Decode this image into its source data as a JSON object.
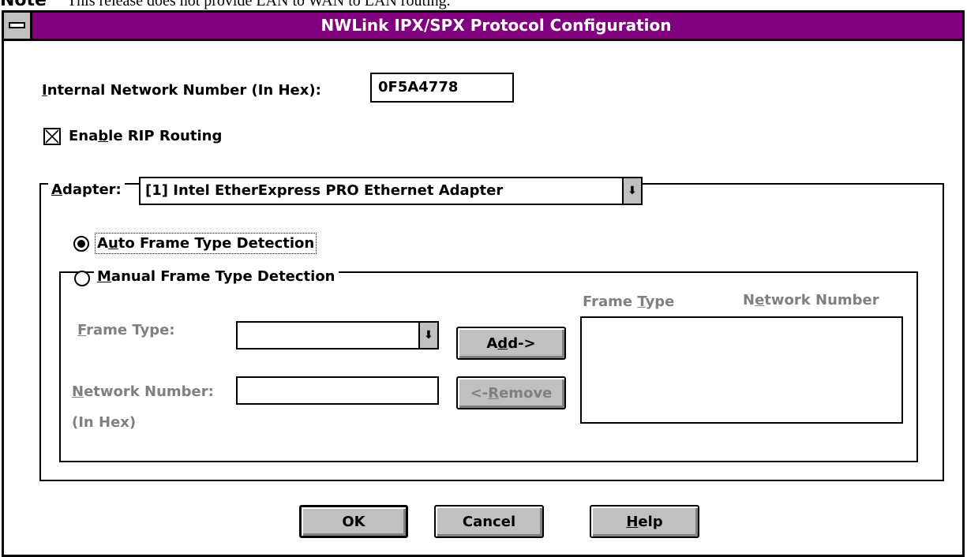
{
  "note": {
    "label": "Note",
    "text": "This release does not provide LAN to WAN to LAN routing."
  },
  "window": {
    "title": "NWLink IPX/SPX Protocol Configuration"
  },
  "internal_network": {
    "label_mnemonic": "I",
    "label_rest": "nternal Network Number (In Hex):",
    "value": "0F5A4778"
  },
  "rip": {
    "label_pre": "Ena",
    "label_mnemonic": "b",
    "label_post": "le RIP Routing",
    "checked": true
  },
  "adapter": {
    "label_mnemonic": "A",
    "label_rest": "dapter:",
    "selected": "[1] Intel EtherExpress PRO Ethernet Adapter"
  },
  "frame_detection": {
    "auto": {
      "pre": "A",
      "mnemonic": "u",
      "post": "to Frame Type Detection",
      "selected": true
    },
    "manual": {
      "mnemonic": "M",
      "post": "anual Frame Type Detection",
      "selected": false
    }
  },
  "manual": {
    "frame_type_label_mnemonic": "F",
    "frame_type_label_rest": "rame Type:",
    "frame_type_value": "",
    "network_number_label_mnemonic": "N",
    "network_number_label_rest": "etwork Number:",
    "network_number_sub": "(In Hex)",
    "network_number_value": "",
    "list_header_frame_pre": "Frame ",
    "list_header_frame_mnemonic": "T",
    "list_header_frame_post": "ype",
    "list_header_net_pre": "N",
    "list_header_net_mnemonic": "e",
    "list_header_net_post": "twork Number",
    "add_pre": "A",
    "add_mnemonic": "d",
    "add_post": "d->",
    "remove_pre": "<-",
    "remove_mnemonic": "R",
    "remove_post": "emove"
  },
  "buttons": {
    "ok": "OK",
    "cancel": "Cancel",
    "help_mnemonic": "H",
    "help_rest": "elp"
  },
  "colors": {
    "titlebar": "#800080",
    "face": "#c0c0c0",
    "disabled_text": "#808080"
  },
  "icons": [
    "system-menu-icon",
    "combo-arrow-icon",
    "radio-icon",
    "checkbox-icon"
  ]
}
